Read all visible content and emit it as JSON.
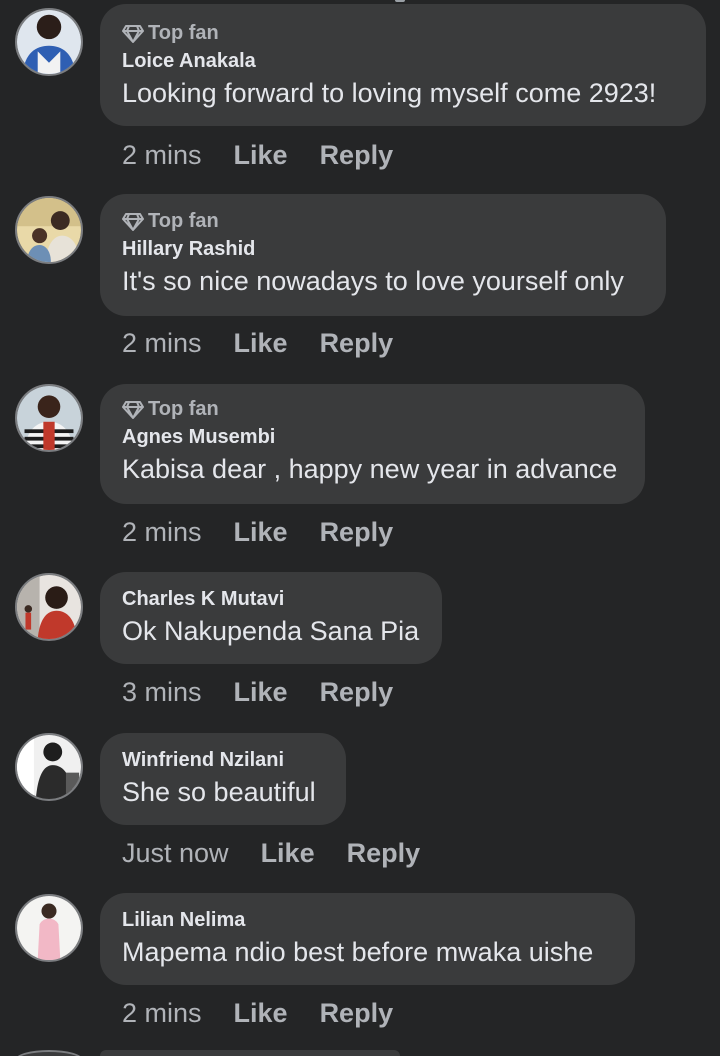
{
  "comments": [
    {
      "badge": "Top fan",
      "author": "Loice Anakala",
      "text": "Looking forward to loving myself come 2923!",
      "time": "2 mins",
      "like": "Like",
      "reply": "Reply"
    },
    {
      "badge": "Top fan",
      "author": "Hillary Rashid",
      "text": "It's so nice nowadays to love yourself only",
      "time": "2 mins",
      "like": "Like",
      "reply": "Reply"
    },
    {
      "badge": "Top fan",
      "author": "Agnes Musembi",
      "text": "Kabisa dear , happy new year in advance",
      "time": "2 mins",
      "like": "Like",
      "reply": "Reply"
    },
    {
      "author": "Charles K Mutavi",
      "text": "Ok Nakupenda Sana Pia",
      "time": "3 mins",
      "like": "Like",
      "reply": "Reply"
    },
    {
      "author": "Winfriend Nzilani",
      "text": "She so beautiful",
      "time": "Just now",
      "like": "Like",
      "reply": "Reply"
    },
    {
      "author": "Lilian Nelima",
      "text": "Mapema ndio best before mwaka uishe",
      "time": "2 mins",
      "like": "Like",
      "reply": "Reply"
    }
  ],
  "icons": {
    "badge": "diamond-icon"
  },
  "colors": {
    "background": "#242526",
    "bubble": "#3a3b3c",
    "primary_text": "#e4e6eb",
    "secondary_text": "#b0b3b8"
  }
}
